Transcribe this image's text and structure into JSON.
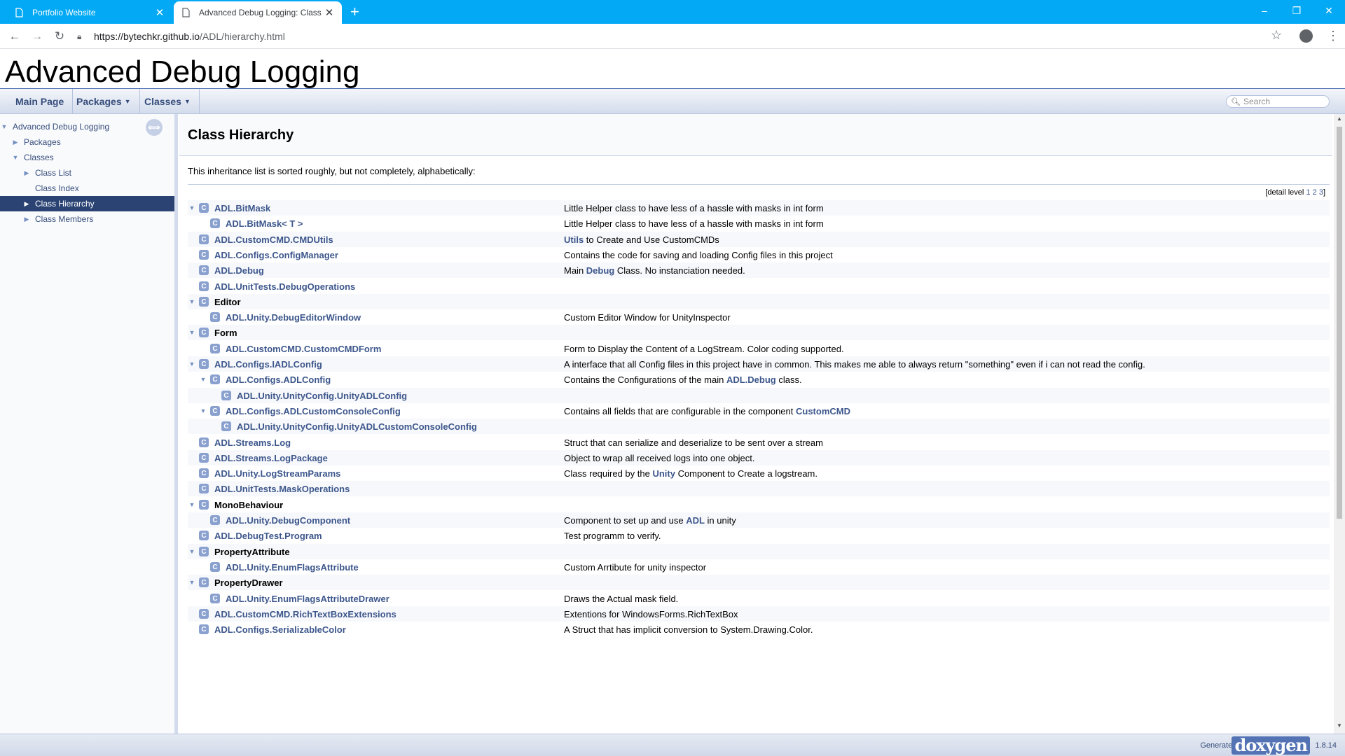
{
  "browser": {
    "tabs": [
      {
        "title": "Portfolio Website",
        "active": false
      },
      {
        "title": "Advanced Debug Logging: Class",
        "active": true
      }
    ],
    "new_tab": "+",
    "url_host": "https://bytechkr.github.io",
    "url_path": "/ADL/hierarchy.html",
    "controls": {
      "minimize": "–",
      "maximize": "❐",
      "close": "✕"
    }
  },
  "project_name": "Advanced Debug Logging",
  "navbar": {
    "main_page": "Main Page",
    "packages": "Packages",
    "classes": "Classes",
    "search_placeholder": "Search"
  },
  "sidenav": [
    {
      "label": "Advanced Debug Logging",
      "arrow": "▼",
      "level": 0
    },
    {
      "label": "Packages",
      "arrow": "▶",
      "level": 1
    },
    {
      "label": "Classes",
      "arrow": "▼",
      "level": 1
    },
    {
      "label": "Class List",
      "arrow": "▶",
      "level": 2
    },
    {
      "label": "Class Index",
      "arrow": "",
      "level": 2
    },
    {
      "label": "Class Hierarchy",
      "arrow": "▶",
      "level": 2,
      "selected": true
    },
    {
      "label": "Class Members",
      "arrow": "▶",
      "level": 2
    }
  ],
  "page_title": "Class Hierarchy",
  "intro": "This inheritance list is sorted roughly, but not completely, alphabetically:",
  "detail_level": {
    "label": "[detail level",
    "levels": [
      "1",
      "2",
      "3"
    ],
    "close": "]"
  },
  "rows": [
    {
      "name": "ADL.BitMask",
      "depth": 0,
      "toggle": "▼",
      "link": true,
      "desc": "Little Helper class to have less of a hassle with masks in int form"
    },
    {
      "name": "ADL.BitMask< T >",
      "depth": 1,
      "toggle": "",
      "link": true,
      "desc": "Little Helper class to have less of a hassle with masks in int form"
    },
    {
      "name": "ADL.CustomCMD.CMDUtils",
      "depth": 0,
      "toggle": "",
      "link": true,
      "desc_link": "Utils",
      "desc": " to Create and Use CustomCMDs"
    },
    {
      "name": "ADL.Configs.ConfigManager",
      "depth": 0,
      "toggle": "",
      "link": true,
      "desc": "Contains the code for saving and loading Config files in this project"
    },
    {
      "name": "ADL.Debug",
      "depth": 0,
      "toggle": "",
      "link": true,
      "desc_pre": "Main ",
      "desc_link": "Debug",
      "desc": " Class. No instanciation needed."
    },
    {
      "name": "ADL.UnitTests.DebugOperations",
      "depth": 0,
      "toggle": "",
      "link": true,
      "desc": ""
    },
    {
      "name": "Editor",
      "depth": 0,
      "toggle": "▼",
      "link": false,
      "desc": ""
    },
    {
      "name": "ADL.Unity.DebugEditorWindow",
      "depth": 1,
      "toggle": "",
      "link": true,
      "desc": "Custom Editor Window for UnityInspector"
    },
    {
      "name": "Form",
      "depth": 0,
      "toggle": "▼",
      "link": false,
      "desc": ""
    },
    {
      "name": "ADL.CustomCMD.CustomCMDForm",
      "depth": 1,
      "toggle": "",
      "link": true,
      "desc": "Form to Display the Content of a LogStream. Color coding supported."
    },
    {
      "name": "ADL.Configs.IADLConfig",
      "depth": 0,
      "toggle": "▼",
      "link": true,
      "desc": "A interface that all Config files in this project have in common. This makes me able to always return \"something\" even if i can not read the config."
    },
    {
      "name": "ADL.Configs.ADLConfig",
      "depth": 1,
      "toggle": "▼",
      "link": true,
      "desc_pre": "Contains the Configurations of the main ",
      "desc_link": "ADL.Debug",
      "desc": " class."
    },
    {
      "name": "ADL.Unity.UnityConfig.UnityADLConfig",
      "depth": 2,
      "toggle": "",
      "link": true,
      "desc": ""
    },
    {
      "name": "ADL.Configs.ADLCustomConsoleConfig",
      "depth": 1,
      "toggle": "▼",
      "link": true,
      "desc_pre": "Contains all fields that are configurable in the component ",
      "desc_link": "CustomCMD",
      "desc": ""
    },
    {
      "name": "ADL.Unity.UnityConfig.UnityADLCustomConsoleConfig",
      "depth": 2,
      "toggle": "",
      "link": true,
      "desc": ""
    },
    {
      "name": "ADL.Streams.Log",
      "depth": 0,
      "toggle": "",
      "link": true,
      "desc": "Struct that can serialize and deserialize to be sent over a stream"
    },
    {
      "name": "ADL.Streams.LogPackage",
      "depth": 0,
      "toggle": "",
      "link": true,
      "desc": "Object to wrap all received logs into one object."
    },
    {
      "name": "ADL.Unity.LogStreamParams",
      "depth": 0,
      "toggle": "",
      "link": true,
      "desc_pre": "Class required by the ",
      "desc_link": "Unity",
      "desc": " Component to Create a logstream."
    },
    {
      "name": "ADL.UnitTests.MaskOperations",
      "depth": 0,
      "toggle": "",
      "link": true,
      "desc": ""
    },
    {
      "name": "MonoBehaviour",
      "depth": 0,
      "toggle": "▼",
      "link": false,
      "desc": ""
    },
    {
      "name": "ADL.Unity.DebugComponent",
      "depth": 1,
      "toggle": "",
      "link": true,
      "desc_pre": "Component to set up and use ",
      "desc_link": "ADL",
      "desc": " in unity"
    },
    {
      "name": "ADL.DebugTest.Program",
      "depth": 0,
      "toggle": "",
      "link": true,
      "desc": "Test programm to verify."
    },
    {
      "name": "PropertyAttribute",
      "depth": 0,
      "toggle": "▼",
      "link": false,
      "desc": ""
    },
    {
      "name": "ADL.Unity.EnumFlagsAttribute",
      "depth": 1,
      "toggle": "",
      "link": true,
      "desc": "Custom Arrtibute for unity inspector"
    },
    {
      "name": "PropertyDrawer",
      "depth": 0,
      "toggle": "▼",
      "link": false,
      "desc": ""
    },
    {
      "name": "ADL.Unity.EnumFlagsAttributeDrawer",
      "depth": 1,
      "toggle": "",
      "link": true,
      "desc": "Draws the Actual mask field."
    },
    {
      "name": "ADL.CustomCMD.RichTextBoxExtensions",
      "depth": 0,
      "toggle": "",
      "link": true,
      "desc": "Extentions for WindowsForms.RichTextBox"
    },
    {
      "name": "ADL.Configs.SerializableColor",
      "depth": 0,
      "toggle": "",
      "link": true,
      "desc": "A Struct that has implicit conversion to System.Drawing.Color."
    }
  ],
  "footer": {
    "generated_by": "Generated by",
    "logo": "doxygen",
    "version": "1.8.14"
  }
}
